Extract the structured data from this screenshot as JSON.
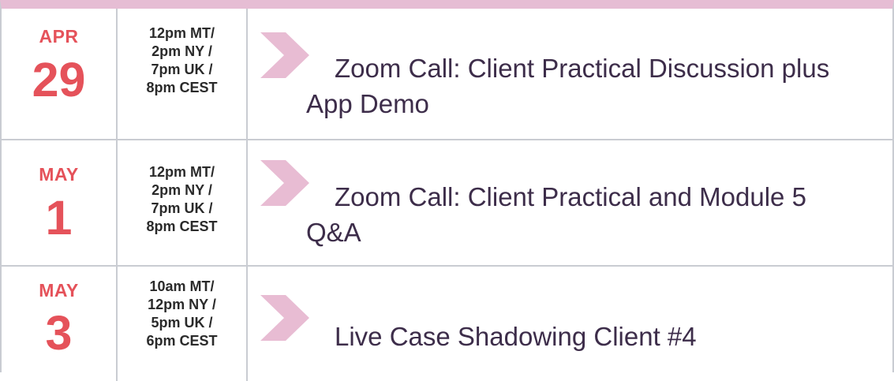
{
  "schedule": {
    "rows": [
      {
        "month": "APR",
        "day": "29",
        "time_lines": [
          "12pm MT/",
          "2pm NY /",
          "7pm UK /",
          "8pm CEST"
        ],
        "event_line_1": "Zoom Call: Client Practical Discussion plus",
        "event_line_2": "App Demo"
      },
      {
        "month": "MAY",
        "day": "1",
        "time_lines": [
          "12pm MT/",
          "2pm NY /",
          "7pm UK /",
          "8pm CEST"
        ],
        "event_line_1": "Zoom Call: Client Practical and Module 5",
        "event_line_2": "Q&A"
      },
      {
        "month": "MAY",
        "day": "3",
        "time_lines": [
          "10am MT/",
          "12pm NY /",
          "5pm UK /",
          "6pm CEST"
        ],
        "event_line_1": "Live Case Shadowing Client #4",
        "event_line_2": ""
      }
    ]
  },
  "colors": {
    "header_bar": "#e6bdd4",
    "date_text": "#e5525a",
    "chevron": "#e8bcd3",
    "event_text": "#3d2d4a",
    "grid": "#c9ccd2"
  },
  "icons": {
    "chevron": "chevron-right-icon"
  }
}
